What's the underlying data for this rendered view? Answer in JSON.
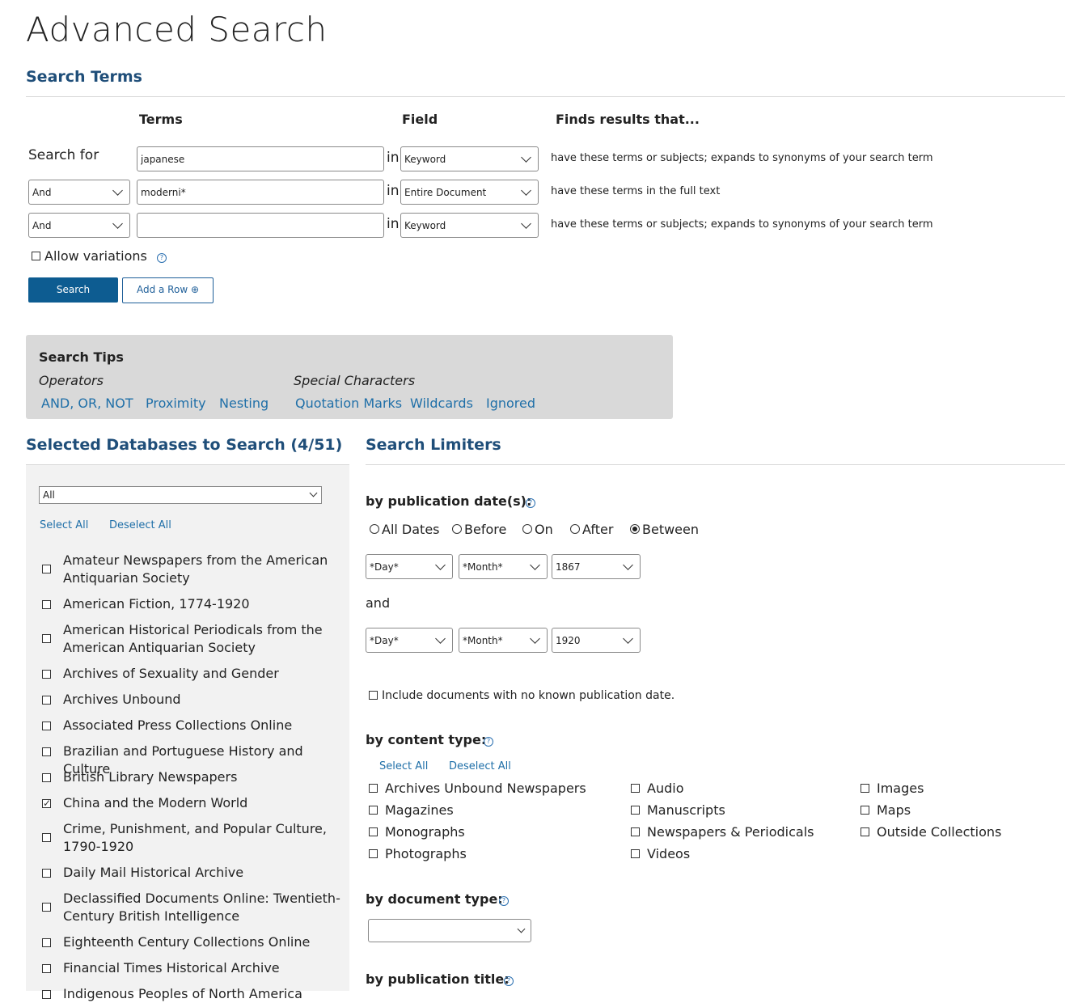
{
  "page": {
    "title": "Advanced Search"
  },
  "search_terms": {
    "heading": "Search Terms",
    "col_terms": "Terms",
    "col_field": "Field",
    "col_finds": "Finds results that...",
    "search_for_label": "Search for",
    "in_label": "in",
    "rows": [
      {
        "operator": "",
        "term": "japanese",
        "field": "Keyword",
        "finds": "have these terms or subjects; expands to synonyms of your search term"
      },
      {
        "operator": "And",
        "term": "moderni*",
        "field": "Entire Document",
        "finds": "have these terms in the full text"
      },
      {
        "operator": "And",
        "term": "",
        "field": "Keyword",
        "finds": "have these terms or subjects; expands to synonyms of your search term"
      }
    ],
    "allow_variations_label": "Allow variations",
    "search_button": "Search",
    "add_row_button": "Add a Row ⊕"
  },
  "search_tips": {
    "heading": "Search Tips",
    "operators_label": "Operators",
    "operators_links": [
      "AND, OR, NOT",
      "Proximity",
      "Nesting"
    ],
    "special_label": "Special Characters",
    "special_links": [
      "Quotation Marks",
      "Wildcards",
      "Ignored"
    ]
  },
  "databases": {
    "heading": "Selected Databases to Search (4/51)",
    "filter_value": "All",
    "select_all": "Select All",
    "deselect_all": "Deselect All",
    "items": [
      {
        "label": "Amateur Newspapers from the American Antiquarian Society",
        "checked": false
      },
      {
        "label": "American Fiction, 1774-1920",
        "checked": false
      },
      {
        "label": "American Historical Periodicals from the American Antiquarian Society",
        "checked": false
      },
      {
        "label": "Archives of Sexuality and Gender",
        "checked": false
      },
      {
        "label": "Archives Unbound",
        "checked": false
      },
      {
        "label": "Associated Press Collections Online",
        "checked": false
      },
      {
        "label": "Brazilian and Portuguese History and Culture",
        "checked": false
      },
      {
        "label": "British Library Newspapers",
        "checked": false
      },
      {
        "label": "China and the Modern World",
        "checked": true
      },
      {
        "label": "Crime, Punishment, and Popular Culture, 1790-1920",
        "checked": false
      },
      {
        "label": "Daily Mail Historical Archive",
        "checked": false
      },
      {
        "label": "Declassified Documents Online: Twentieth-Century British Intelligence",
        "checked": false
      },
      {
        "label": "Eighteenth Century Collections Online",
        "checked": false
      },
      {
        "label": "Financial Times Historical Archive",
        "checked": false
      },
      {
        "label": "Indigenous Peoples of North America",
        "checked": false
      }
    ]
  },
  "limiters": {
    "heading": "Search Limiters",
    "pub_date_label": "by publication date(s):",
    "date_options": [
      {
        "label": "All Dates",
        "selected": false
      },
      {
        "label": "Before",
        "selected": false
      },
      {
        "label": "On",
        "selected": false
      },
      {
        "label": "After",
        "selected": false
      },
      {
        "label": "Between",
        "selected": true
      }
    ],
    "from": {
      "day": "*Day*",
      "month": "*Month*",
      "year": "1867"
    },
    "and_label": "and",
    "to": {
      "day": "*Day*",
      "month": "*Month*",
      "year": "1920"
    },
    "no_date_label": "Include documents with no known publication date.",
    "content_type_label": "by content type:",
    "ct_select_all": "Select All",
    "ct_deselect_all": "Deselect All",
    "content_types": [
      "Archives Unbound Newspapers",
      "Audio",
      "Images",
      "Magazines",
      "Manuscripts",
      "Maps",
      "Monographs",
      "Newspapers & Periodicals",
      "Outside Collections",
      "Photographs",
      "Videos"
    ],
    "doc_type_label": "by document type:",
    "doc_type_value": "",
    "pub_title_label": "by publication title:"
  },
  "icons": {
    "help": "help-icon",
    "dropdown": "chevron-down-icon",
    "plus": "plus-circle-icon"
  },
  "colors": {
    "heading": "#1f4e79",
    "link": "#1f6fa8",
    "primary_button": "#0d5c91",
    "tips_bg": "#d9d9d9",
    "db_panel_bg": "#f2f2f2"
  }
}
